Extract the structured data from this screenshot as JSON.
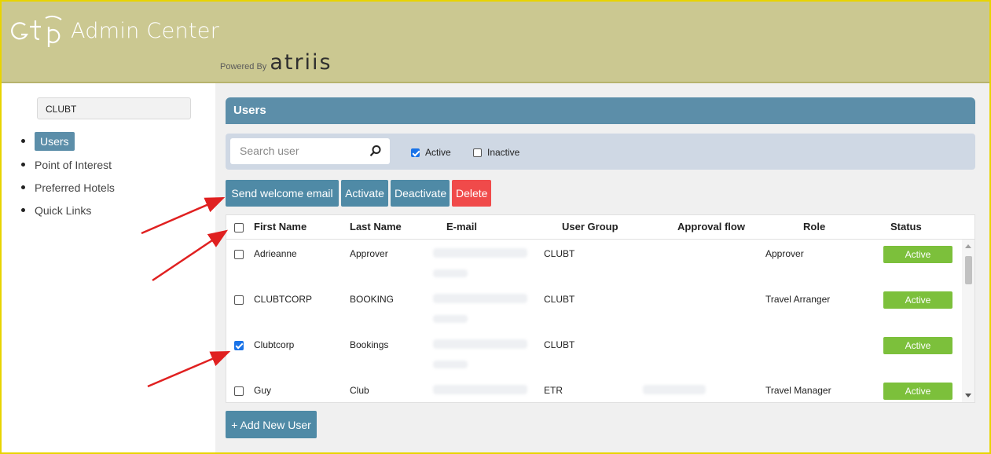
{
  "header": {
    "logo_text": "GTP",
    "app_title": "Admin Center",
    "powered_by": "Powered By",
    "brand": "atriis"
  },
  "sidebar": {
    "company": "CLUBT",
    "items": [
      {
        "label": "Users",
        "active": true
      },
      {
        "label": "Point of Interest",
        "active": false
      },
      {
        "label": "Preferred Hotels",
        "active": false
      },
      {
        "label": "Quick Links",
        "active": false
      }
    ]
  },
  "main": {
    "title": "Users",
    "search": {
      "placeholder": "Search user"
    },
    "filters": {
      "active": {
        "label": "Active",
        "checked": true
      },
      "inactive": {
        "label": "Inactive",
        "checked": false
      }
    },
    "actions": {
      "send_welcome": "Send welcome email",
      "activate": "Activate",
      "deactivate": "Deactivate",
      "delete": "Delete"
    },
    "table": {
      "columns": [
        "First Name",
        "Last Name",
        "E-mail",
        "User Group",
        "Approval flow",
        "Role",
        "Status"
      ],
      "rows": [
        {
          "first": "Adrieanne",
          "last": "Approver",
          "group": "CLUBT",
          "approval": "",
          "role": "Approver",
          "status": "Active",
          "checked": false
        },
        {
          "first": "CLUBTCORP",
          "last": "BOOKING",
          "group": "CLUBT",
          "approval": "",
          "role": "Travel Arranger",
          "status": "Active",
          "checked": false
        },
        {
          "first": "Clubtcorp",
          "last": "Bookings",
          "group": "CLUBT",
          "approval": "",
          "role": "",
          "status": "Active",
          "checked": true
        },
        {
          "first": "Guy",
          "last": "Club",
          "group": "ETR",
          "approval": "",
          "role": "Travel Manager",
          "status": "Active",
          "checked": false
        }
      ]
    },
    "add_user": "+ Add New User"
  },
  "colors": {
    "header_bg": "#cbc891",
    "accent": "#5c8ea9",
    "button": "#4f8aa6",
    "danger": "#f04a4a",
    "status_active": "#7cc03b",
    "annotation_arrow": "#e02020"
  }
}
